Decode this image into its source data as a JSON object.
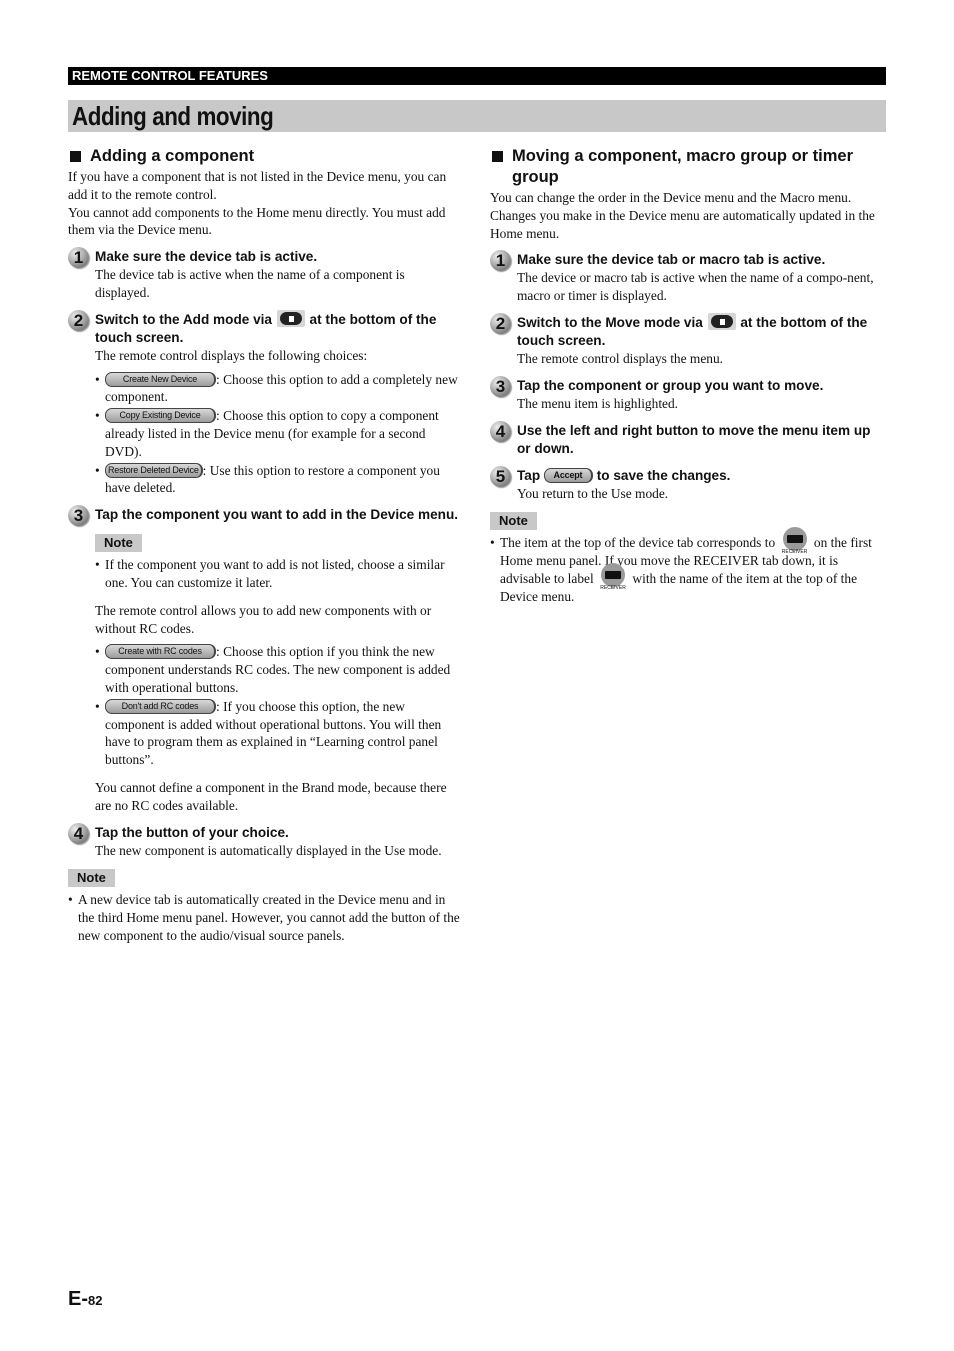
{
  "header": {
    "section": "REMOTE CONTROL FEATURES",
    "title": "Adding and moving"
  },
  "left": {
    "heading": "Adding a component",
    "intro": [
      "If you have a component that is not listed in the Device menu, you can add it to the remote control.",
      "You cannot add components to the Home menu directly. You must add them via the Device menu."
    ],
    "steps": [
      {
        "num": "1",
        "title": "Make sure the device tab is active.",
        "body": "The device tab is active when the name of a component is displayed."
      },
      {
        "num": "2",
        "title_pre": "Switch to the Add mode via",
        "title_post": "at the bottom of the touch screen.",
        "body": "The remote control displays the following choices:",
        "options": [
          {
            "button": "Create New Device",
            "text": ": Choose this option to add a completely new component."
          },
          {
            "button": "Copy Existing Device",
            "text": ": Choose this option to copy a component already listed in the Device menu (for example for a second DVD)."
          },
          {
            "button": "Restore Deleted Device",
            "text": ": Use this option to restore a component you have deleted."
          }
        ]
      },
      {
        "num": "3",
        "title": "Tap the component you want to add in the Device menu.",
        "note_label": "Note",
        "note": "If the component you want to add is not listed, choose a similar one. You can customize it later.",
        "para1": "The remote control allows you to add new components with or without RC codes.",
        "options": [
          {
            "button": "Create with RC codes",
            "text": ": Choose this option if you think the new component understands RC codes. The new component is added with operational buttons."
          },
          {
            "button": "Don't add RC codes",
            "text": ": If you choose this option, the new component is added without operational buttons. You will then have to program them as explained in “Learning control panel buttons”."
          }
        ],
        "para2": "You cannot define a component in the Brand mode, because there are no RC codes available."
      },
      {
        "num": "4",
        "title": "Tap the button of your choice.",
        "body": "The new component is automatically displayed in the Use mode."
      }
    ],
    "note_label": "Note",
    "note": "A new device tab is automatically created in the Device menu and in the third Home menu panel. However, you cannot add the button of the new component to the audio/visual source panels."
  },
  "right": {
    "heading": "Moving a component, macro group or timer group",
    "intro": "You can change the order in the Device menu and the Macro menu. Changes you make in the Device menu are automatically updated in the Home menu.",
    "steps": [
      {
        "num": "1",
        "title": "Make sure the device tab or macro tab is active.",
        "body": "The device or macro tab is active when the name of a compo-nent, macro or timer is displayed."
      },
      {
        "num": "2",
        "title_pre": "Switch to the Move mode via",
        "title_post": "at the bottom of the touch screen.",
        "body": "The remote control displays the menu."
      },
      {
        "num": "3",
        "title": "Tap the component or group you want to move.",
        "body": "The menu item is highlighted."
      },
      {
        "num": "4",
        "title": "Use the left and right button to move the menu item up or down."
      },
      {
        "num": "5",
        "title_pre": "Tap",
        "button": "Accept",
        "title_post": "to save the changes.",
        "body": "You return to the Use mode."
      }
    ],
    "note_label": "Note",
    "note_part1": "The item at the top of the device tab corresponds to",
    "note_part2": "on the first Home menu panel. If you move the RECEIVER tab down, it is advisable to label",
    "note_part3": "with the name of the item at the top of the Device menu.",
    "receiver_icon_label": "RECEIVER"
  },
  "footer": {
    "page_prefix": "E-",
    "page_number": "82"
  }
}
